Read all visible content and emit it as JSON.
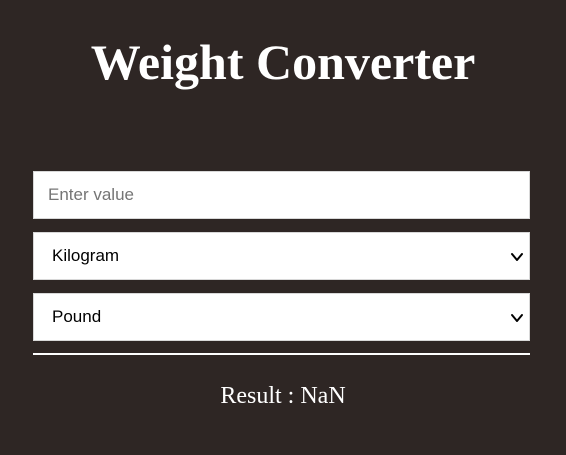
{
  "app": {
    "title": "Weight Converter"
  },
  "form": {
    "value_input": {
      "placeholder": "Enter value",
      "value": ""
    },
    "from_unit": {
      "selected": "Kilogram"
    },
    "to_unit": {
      "selected": "Pound"
    }
  },
  "result": {
    "label": "Result : NaN"
  },
  "colors": {
    "background": "#2e2624",
    "text": "#ffffff",
    "field_background": "#ffffff",
    "placeholder": "#757575"
  },
  "icons": {
    "select_arrow": "chevron-down-icon"
  }
}
